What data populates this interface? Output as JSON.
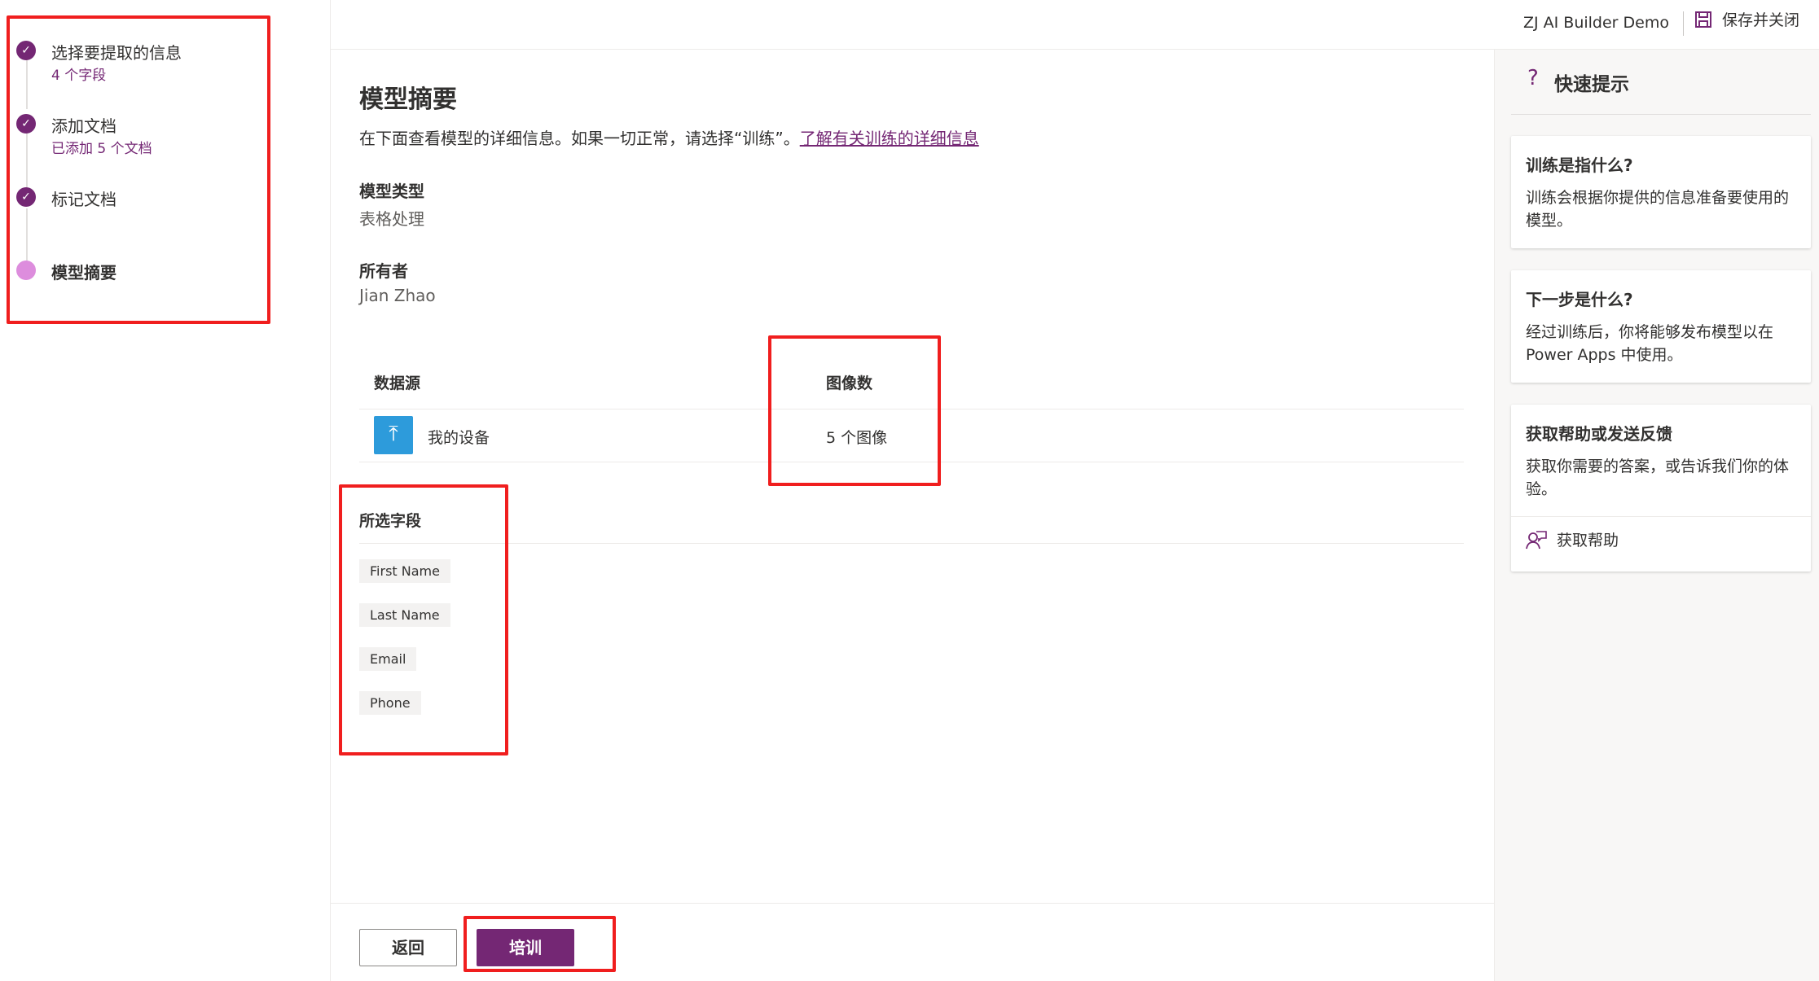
{
  "steps": [
    {
      "label": "选择要提取的信息",
      "sub": "4 个字段",
      "state": "done"
    },
    {
      "label": "添加文档",
      "sub": "已添加 5 个文档",
      "state": "done"
    },
    {
      "label": "标记文档",
      "sub": "",
      "state": "done"
    },
    {
      "label": "模型摘要",
      "sub": "",
      "state": "current"
    }
  ],
  "header": {
    "app_name": "ZJ AI Builder Demo",
    "save_close": "保存并关闭",
    "save_icon": "save-icon"
  },
  "main": {
    "title": "模型摘要",
    "description": "在下面查看模型的详细信息。如果一切正常，请选择“训练”。",
    "learn_more_link": "了解有关训练的详细信息",
    "model_type_label": "模型类型",
    "model_type_value": "表格处理",
    "owner_label": "所有者",
    "owner_value": "Jian Zhao",
    "table": {
      "headers": [
        "数据源",
        "图像数"
      ],
      "rows": [
        {
          "source": "我的设备",
          "count": "5 个图像",
          "icon": "upload-icon"
        }
      ]
    },
    "fields_label": "所选字段",
    "fields": [
      "First Name",
      "Last Name",
      "Email",
      "Phone"
    ]
  },
  "footer": {
    "back": "返回",
    "train": "培训"
  },
  "tips": {
    "title": "快速提示",
    "cards": [
      {
        "title": "训练是指什么?",
        "body": "训练会根据你提供的信息准备要使用的模型。"
      },
      {
        "title": "下一步是什么?",
        "body": "经过训练后，你将能够发布模型以在 Power Apps 中使用。"
      },
      {
        "title": "获取帮助或发送反馈",
        "body": "获取你需要的答案，或告诉我们你的体验。",
        "link": "获取帮助"
      }
    ]
  },
  "colors": {
    "accent": "#742774",
    "current_step": "#dd8ddd",
    "highlight": "#f01e1e",
    "upload_icon_bg": "#2d9bdb"
  }
}
